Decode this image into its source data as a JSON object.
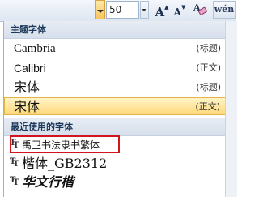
{
  "toolbar": {
    "font_size_value": "50",
    "grow_font_label": "A",
    "shrink_font_label": "A",
    "clear_format_icon": "eraser-icon",
    "phonetic_label": "wén"
  },
  "theme_section": {
    "header": "主题字体",
    "items": [
      {
        "name": "Cambria",
        "tag": "(标题)"
      },
      {
        "name": "Calibri",
        "tag": "(正文)"
      },
      {
        "name": "宋体",
        "tag": "(标题)"
      },
      {
        "name": "宋体",
        "tag": "(正文)"
      }
    ]
  },
  "recent_section": {
    "header": "最近使用的字体",
    "items": [
      {
        "name": "禹卫书法隶书繁体"
      },
      {
        "name": "楷体_GB2312"
      },
      {
        "name": "华文行楷"
      }
    ]
  },
  "colors": {
    "selected_bg": "#ffd97a",
    "highlight_border": "#d2151c",
    "header_text": "#1e395b"
  }
}
